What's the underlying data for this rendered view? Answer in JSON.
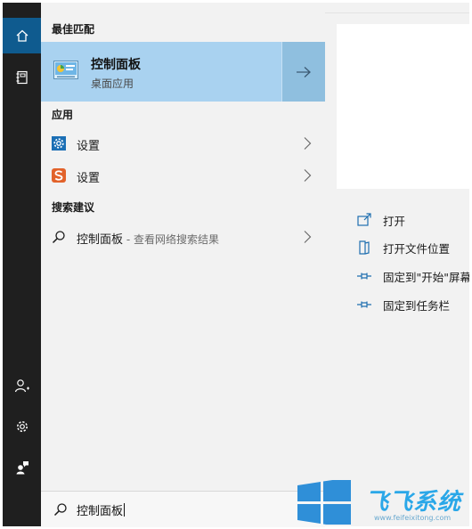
{
  "sections": {
    "best_match": "最佳匹配",
    "apps": "应用",
    "search_suggestions": "搜索建议"
  },
  "best_match": {
    "title": "控制面板",
    "subtitle": "桌面应用"
  },
  "apps": [
    {
      "label": "设置",
      "icon": "gear-settings-icon"
    },
    {
      "label": "设置",
      "icon": "sogou-s-icon"
    }
  ],
  "suggestions": [
    {
      "label": "控制面板",
      "hint": " - 查看网络搜索结果"
    }
  ],
  "actions": [
    {
      "label": "打开",
      "icon": "open-icon"
    },
    {
      "label": "打开文件位置",
      "icon": "file-location-icon"
    },
    {
      "label": "固定到\"开始\"屏幕",
      "icon": "pin-icon"
    },
    {
      "label": "固定到任务栏",
      "icon": "pin-icon"
    }
  ],
  "search": {
    "query": "控制面板"
  },
  "watermark": {
    "text": "飞飞系统",
    "url": "www.feifeixitong.com"
  },
  "colors": {
    "accent": "#0f5b8f",
    "selection": "#a9d2f0",
    "rail": "#1f1f1f",
    "action_icon": "#1f6fb0"
  }
}
